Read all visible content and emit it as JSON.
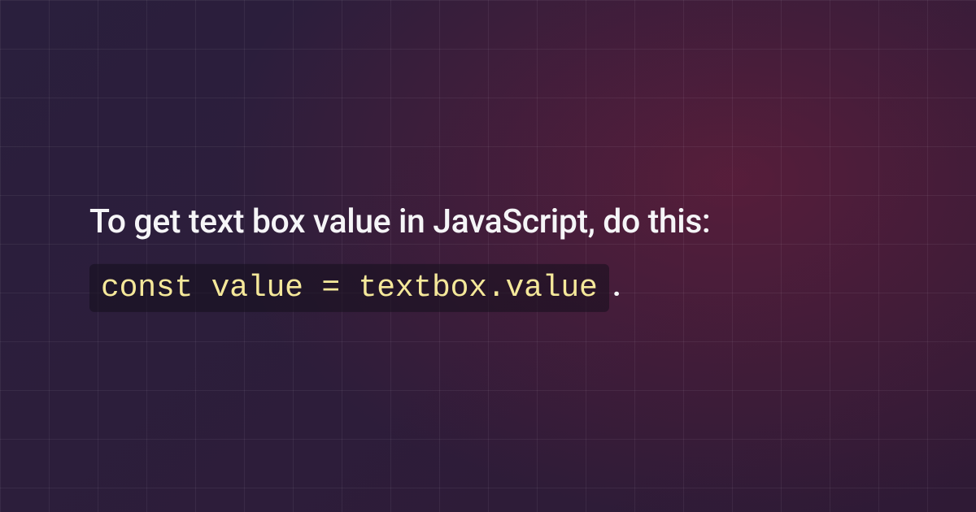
{
  "heading": "To get text box value in JavaScript, do this:",
  "code": "const value = textbox.value",
  "period": "."
}
